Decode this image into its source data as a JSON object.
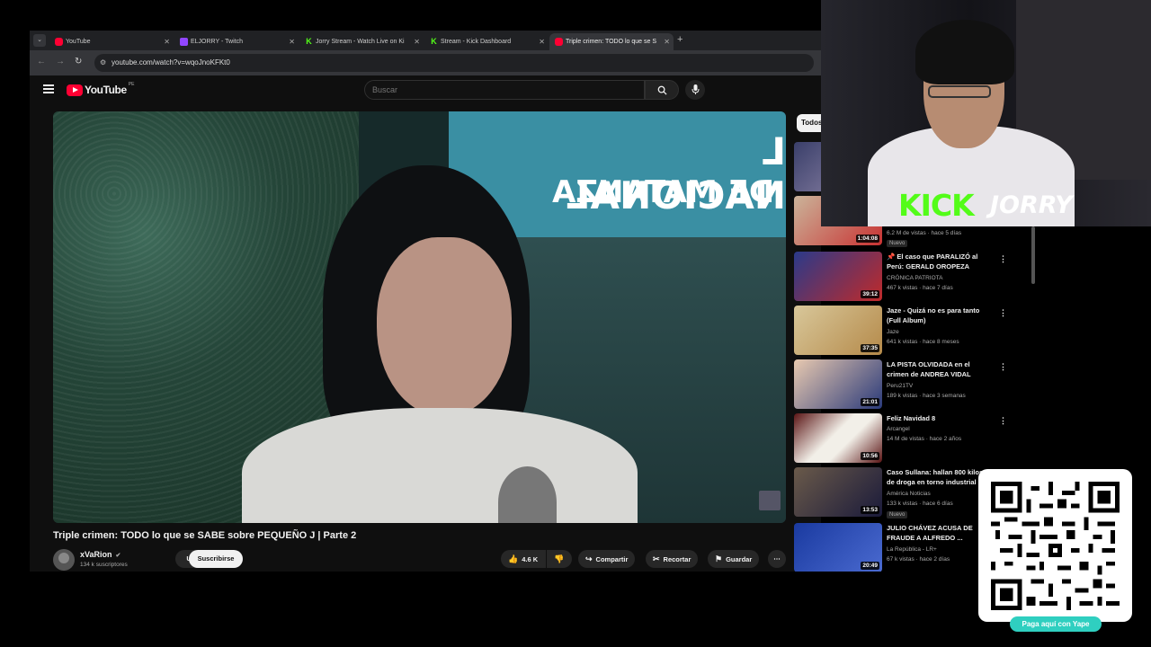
{
  "browser": {
    "tabs": [
      {
        "label": "YouTube",
        "icon": "youtube-favicon"
      },
      {
        "label": "ELJORRY - Twitch",
        "icon": "twitch-favicon"
      },
      {
        "label": "Jorry Stream - Watch Live on Ki",
        "icon": "kick-favicon"
      },
      {
        "label": "Stream - Kick Dashboard",
        "icon": "kick-favicon"
      },
      {
        "label": "Triple crimen: TODO lo que se S",
        "icon": "youtube-favicon"
      }
    ],
    "url": "youtube.com/watch?v=wqoJnoKFKt0"
  },
  "youtube": {
    "logo_text": "YouTube",
    "country": "PE",
    "search_placeholder": "Buscar",
    "chip_all": "Todos",
    "video": {
      "title": "Triple crimen: TODO lo que se SABE sobre PEQUEÑO J | Parte 2",
      "channel": "xVaRion",
      "subscribers": "134 k suscriptores",
      "join_label": "Unirse",
      "subscribe_label": "Suscribirse",
      "likes": "4.6 K",
      "share_label": "Compartir",
      "clip_label": "Recortar",
      "save_label": "Guardar",
      "sign_line1": "L NACIONAL",
      "sign_line2": "DE MATANZA"
    },
    "recommendations": [
      {
        "title": "",
        "channel": "",
        "meta": "6.2 M de vistas · hace 5 días",
        "duration": "1:04:08",
        "badge": "Nuevo"
      },
      {
        "title": "📌 El caso que PARALIZÓ al Perú: GERALD OROPEZA",
        "channel": "CRÓNICA PATRIOTA",
        "meta": "467 k vistas · hace 7 días",
        "duration": "39:12",
        "badge": ""
      },
      {
        "title": "Jaze - Quizá no es para tanto (Full Album)",
        "channel": "Jaze",
        "meta": "641 k vistas · hace 8 meses",
        "duration": "37:35",
        "badge": ""
      },
      {
        "title": "LA PISTA OLVIDADA en el crimen de ANDREA VIDAL",
        "channel": "Peru21TV",
        "meta": "189 k vistas · hace 3 semanas",
        "duration": "21:01",
        "badge": ""
      },
      {
        "title": "Feliz Navidad 8",
        "channel": "Arcangel",
        "meta": "14 M de vistas · hace 2 años",
        "duration": "10:56",
        "badge": ""
      },
      {
        "title": "Caso Sullana: hallan 800 kilos de droga en torno industrial",
        "channel": "América Noticias",
        "meta": "133 k vistas · hace 6 días",
        "duration": "13:53",
        "badge": "Nuevo"
      },
      {
        "title": "JULIO CHÁVEZ ACUSA DE FRAUDE A ALFREDO ...",
        "channel": "La República - LR+",
        "meta": "67 k vistas · hace 2 días",
        "duration": "20:49",
        "badge": ""
      }
    ]
  },
  "overlay": {
    "kick_logo": "KICK",
    "streamer": "JORRY",
    "qr_button": "Paga aquí con Yape"
  },
  "colors": {
    "youtube_red": "#ff0033",
    "kick_green": "#53fc18",
    "yape_teal": "#2fcfc0"
  }
}
